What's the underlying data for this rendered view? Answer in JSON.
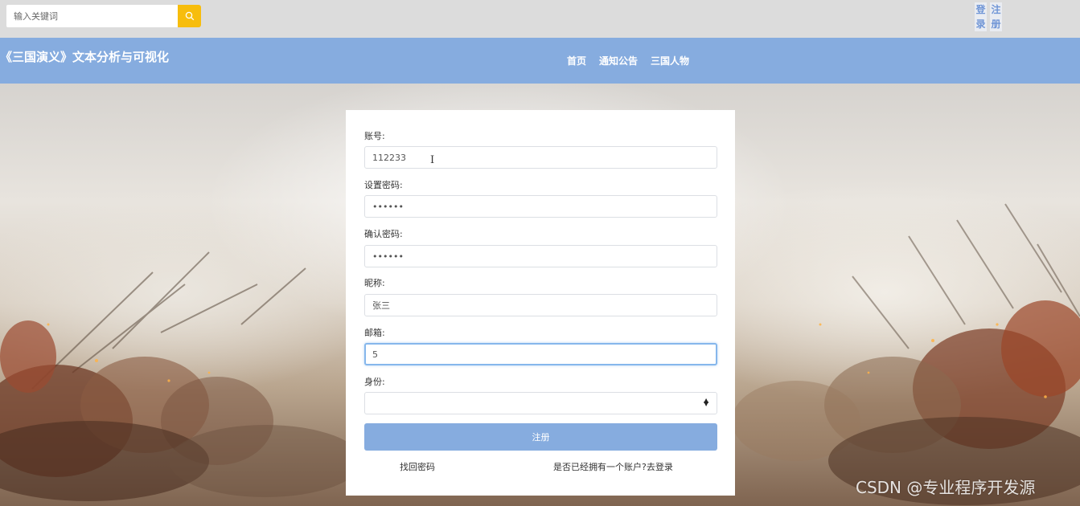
{
  "search": {
    "placeholder": "输入关键词"
  },
  "auth": {
    "login_label": "登录",
    "register_label": "注册"
  },
  "header": {
    "title": "《三国演义》文本分析与可视化",
    "nav": [
      "首页",
      "通知公告",
      "三国人物"
    ]
  },
  "form": {
    "account": {
      "label": "账号:",
      "value": "112233"
    },
    "password": {
      "label": "设置密码:",
      "value": "••••••"
    },
    "confirm_password": {
      "label": "确认密码:",
      "value": "••••••"
    },
    "nickname": {
      "label": "昵称:",
      "value": "张三"
    },
    "email": {
      "label": "邮箱:",
      "value": "5"
    },
    "identity": {
      "label": "身份:",
      "value": ""
    },
    "submit_label": "注册",
    "forgot_password_label": "找回密码",
    "go_login_label": "是否已经拥有一个账户?去登录"
  },
  "watermark": "CSDN @专业程序开发源",
  "colors": {
    "topbar": "#dcdcdc",
    "header": "#86acdf",
    "search_button": "#f7bd0d",
    "submit_button": "#86acdf",
    "focus_border": "#86b7ec"
  }
}
